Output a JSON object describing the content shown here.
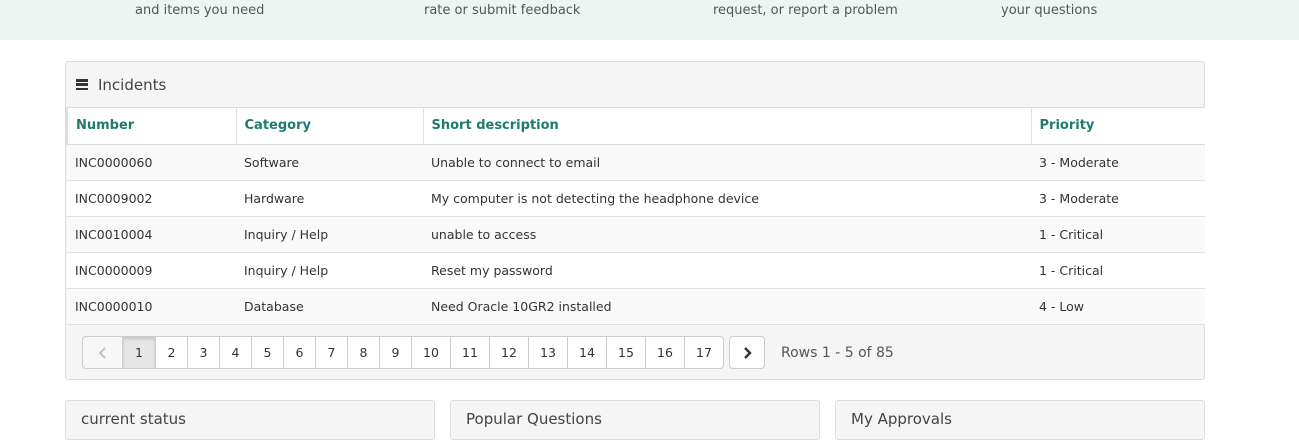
{
  "top_band": {
    "snippets": [
      "and items you need",
      "rate or submit feedback",
      "request, or report a problem",
      "your questions"
    ]
  },
  "incidents": {
    "title": "Incidents",
    "columns": [
      "Number",
      "Category",
      "Short description",
      "Priority"
    ],
    "rows": [
      [
        "INC0000060",
        "Software",
        "Unable to connect to email",
        "3 - Moderate"
      ],
      [
        "INC0009002",
        "Hardware",
        "My computer is not detecting the headphone device",
        "3 - Moderate"
      ],
      [
        "INC0010004",
        "Inquiry / Help",
        "unable to access",
        "1 - Critical"
      ],
      [
        "INC0000009",
        "Inquiry / Help",
        "Reset my password",
        "1 - Critical"
      ],
      [
        "INC0000010",
        "Database",
        "Need Oracle 10GR2 installed",
        "4 - Low"
      ]
    ],
    "pagination": {
      "pages": [
        "1",
        "2",
        "3",
        "4",
        "5",
        "6",
        "7",
        "8",
        "9",
        "10",
        "11",
        "12",
        "13",
        "14",
        "15",
        "16",
        "17"
      ],
      "current": "1",
      "rows_info": "Rows 1 - 5 of 85"
    }
  },
  "cards": [
    "current status",
    "Popular Questions",
    "My Approvals"
  ],
  "icons": {
    "menu": "hamburger-menu-icon",
    "prev": "chevron-left-icon",
    "next": "chevron-right-icon"
  },
  "colors": {
    "accent": "#1f7a6f",
    "band": "#edf5f3"
  }
}
